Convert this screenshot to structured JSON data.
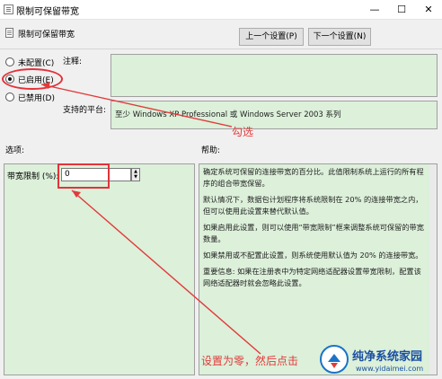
{
  "window": {
    "title": "限制可保留带宽",
    "min_glyph": "—",
    "max_glyph": "☐",
    "close_glyph": "✕"
  },
  "header": {
    "title": "限制可保留带宽",
    "prev_button": "上一个设置(P)",
    "next_button": "下一个设置(N)"
  },
  "radios": [
    {
      "label": "未配置(C)",
      "checked": false
    },
    {
      "label": "已启用(E)",
      "checked": true
    },
    {
      "label": "已禁用(D)",
      "checked": false
    }
  ],
  "comment": {
    "label": "注释:",
    "value": ""
  },
  "platform": {
    "label": "支持的平台:",
    "value": "至少 Windows XP Professional 或 Windows Server 2003 系列"
  },
  "sections": {
    "options_label": "选项:",
    "help_label": "帮助:"
  },
  "options": {
    "bandwidth_label": "带宽限制 (%):",
    "bandwidth_value": "0"
  },
  "help": {
    "paragraphs": [
      "确定系统可保留的连接带宽的百分比。此值限制系统上运行的所有程序的组合带宽保留。",
      "默认情况下，数据包计划程序将系统限制在 20% 的连接带宽之内，但可以使用此设置来替代默认值。",
      "如果启用此设置，则可以使用“带宽限制”框来调整系统可保留的带宽数量。",
      "如果禁用或不配置此设置，则系统使用默认值为 20% 的连接带宽。",
      "重要信息: 如果在注册表中为特定网络适配器设置带宽限制，配置该网络适配器时就会忽略此设置。"
    ]
  },
  "annotations": {
    "check_note": "勾选",
    "zero_note": "设置为零，然后点击",
    "color": "#e23a3a"
  },
  "watermark": {
    "brand": "纯净系统家园",
    "url": "www.yidaimei.com"
  }
}
